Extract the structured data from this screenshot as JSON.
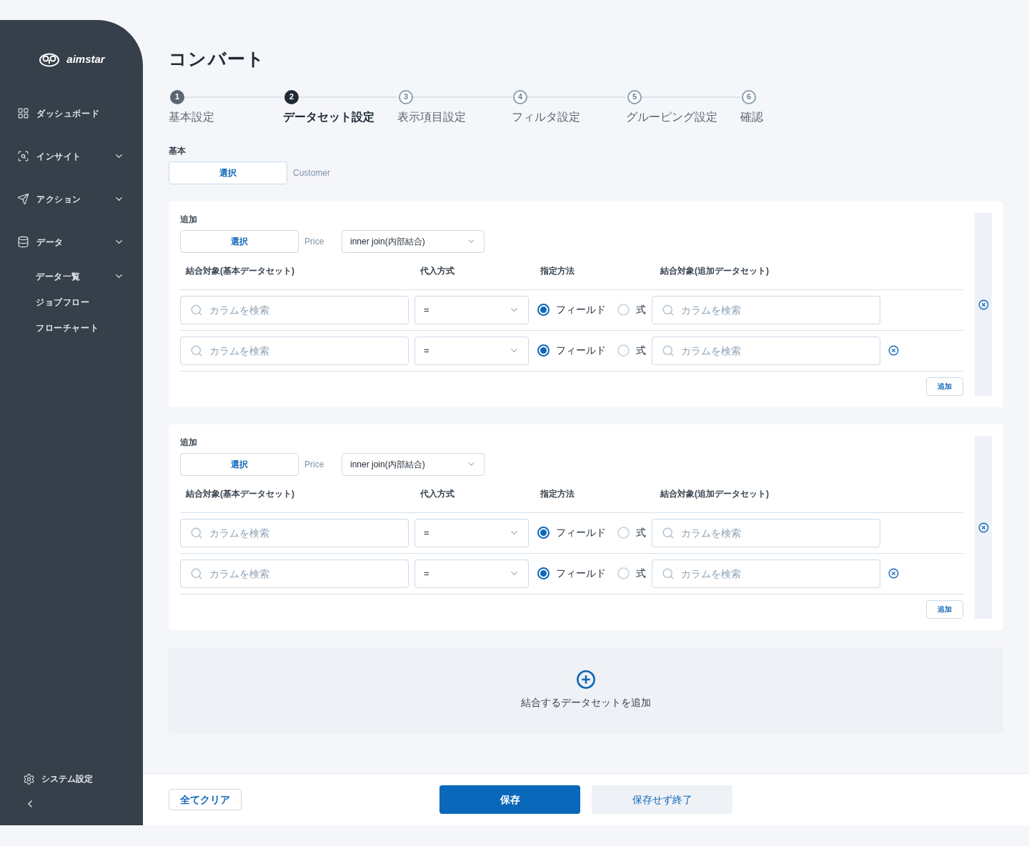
{
  "sidebar": {
    "logo": "aimstar",
    "items": [
      {
        "kind": "grid",
        "label": "ダッシュボード",
        "expandable": false
      },
      {
        "kind": "insight",
        "label": "インサイト",
        "expandable": true
      },
      {
        "kind": "send",
        "label": "アクション",
        "expandable": true
      },
      {
        "kind": "database",
        "label": "データ",
        "expandable": true,
        "children": [
          {
            "label": "データ一覧",
            "expandable": true
          },
          {
            "label": "ジョブフロー",
            "expandable": false
          },
          {
            "label": "フローチャート",
            "expandable": false
          }
        ]
      }
    ],
    "footer_item": {
      "label": "システム設定"
    }
  },
  "page": {
    "title": "コンバート"
  },
  "steps": [
    {
      "number": "1",
      "label": "基本設定",
      "done": true,
      "selected": false
    },
    {
      "number": "2",
      "label": "データセット設定",
      "done": false,
      "selected": true
    },
    {
      "number": "3",
      "label": "表示項目設定",
      "done": false,
      "selected": false
    },
    {
      "number": "4",
      "label": "フィルタ設定",
      "done": false,
      "selected": false
    },
    {
      "number": "5",
      "label": "グルーピング設定",
      "done": false,
      "selected": false
    },
    {
      "number": "6",
      "label": "確認",
      "done": false,
      "selected": false
    }
  ],
  "base": {
    "label": "基本",
    "button": "選択",
    "dataset": "Customer"
  },
  "joins": [
    {
      "label": "追加",
      "button": "選択",
      "dataset": "Price",
      "join_type": "inner join(内部結合)",
      "columns": [
        "結合対象(基本データセット)",
        "代入方式",
        "指定方法",
        "結合対象(追加データセット)"
      ],
      "rows": [
        {
          "left_placeholder": "カラムを検索",
          "operator": "=",
          "options": [
            {
              "label": "フィールド",
              "selected": true
            },
            {
              "label": "式",
              "selected": false
            }
          ],
          "right_placeholder": "カラムを検索",
          "removable": false
        },
        {
          "left_placeholder": "カラムを検索",
          "operator": "=",
          "options": [
            {
              "label": "フィールド",
              "selected": true
            },
            {
              "label": "式",
              "selected": false
            }
          ],
          "right_placeholder": "カラムを検索",
          "removable": true
        }
      ],
      "add_button": "追加",
      "removable": true
    },
    {
      "label": "追加",
      "button": "選択",
      "dataset": "Price",
      "join_type": "inner join(内部結合)",
      "columns": [
        "結合対象(基本データセット)",
        "代入方式",
        "指定方法",
        "結合対象(追加データセット)"
      ],
      "rows": [
        {
          "left_placeholder": "カラムを検索",
          "operator": "=",
          "options": [
            {
              "label": "フィールド",
              "selected": true
            },
            {
              "label": "式",
              "selected": false
            }
          ],
          "right_placeholder": "カラムを検索",
          "removable": false
        },
        {
          "left_placeholder": "カラムを検索",
          "operator": "=",
          "options": [
            {
              "label": "フィールド",
              "selected": true
            },
            {
              "label": "式",
              "selected": false
            }
          ],
          "right_placeholder": "カラムを検索",
          "removable": true
        }
      ],
      "add_button": "追加",
      "removable": true
    }
  ],
  "add_dataset": {
    "label": "結合するデータセットを追加"
  },
  "footer": {
    "clear": "全てクリア",
    "save": "保存",
    "exit": "保存せず終了"
  }
}
